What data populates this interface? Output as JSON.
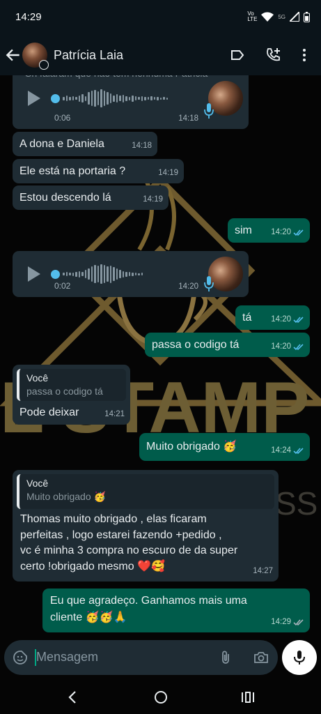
{
  "status": {
    "time": "14:29",
    "network": "Vo LTE",
    "signal2": "5G"
  },
  "header": {
    "contact_name": "Patrícia Laia"
  },
  "messages": {
    "m0": {
      "clipped_text": "Sh falaram que não tem nenhuma Patricia",
      "duration": "0:06",
      "time": "14:18"
    },
    "m1": {
      "text": "A dona e Daniela",
      "time": "14:18"
    },
    "m2": {
      "text": "Ele está na portaria ?",
      "time": "14:19"
    },
    "m3": {
      "text": "Estou descendo lá",
      "time": "14:19"
    },
    "m4": {
      "text": "sim",
      "time": "14:20"
    },
    "m5": {
      "duration": "0:02",
      "time": "14:20"
    },
    "m6": {
      "text": "tá",
      "time": "14:20"
    },
    "m7": {
      "text": "passa o codigo tá",
      "time": "14:20"
    },
    "m8": {
      "quote_author": "Você",
      "quote_text": "passa o codigo tá",
      "text": "Pode deixar",
      "time": "14:21"
    },
    "m9": {
      "text": "Muito obrigado 🥳",
      "time": "14:24"
    },
    "m10": {
      "quote_author": "Você",
      "quote_text": "Muito obrigado 🥳",
      "line1": "Thomas muito obrigado , elas ficaram",
      "line2": "perfeitas , logo estarei fazendo +pedido ,",
      "line3": "vc é minha 3 compra no escuro de da super",
      "line4": "certo !obrigado mesmo ❤️🥰",
      "time": "14:27"
    },
    "m11": {
      "line1": "Eu que agradeço. Ganhamos mais uma",
      "line2": "cliente 🥳🥳🙏",
      "time": "14:29"
    }
  },
  "wallpaper": {
    "word": "L'STAMP",
    "sub": "SS"
  },
  "composer": {
    "placeholder": "Mensagem"
  },
  "colors": {
    "incoming": "#1f2c34",
    "outgoing": "#005c4b",
    "read_ticks": "#53bdeb",
    "accent": "#00a884"
  }
}
